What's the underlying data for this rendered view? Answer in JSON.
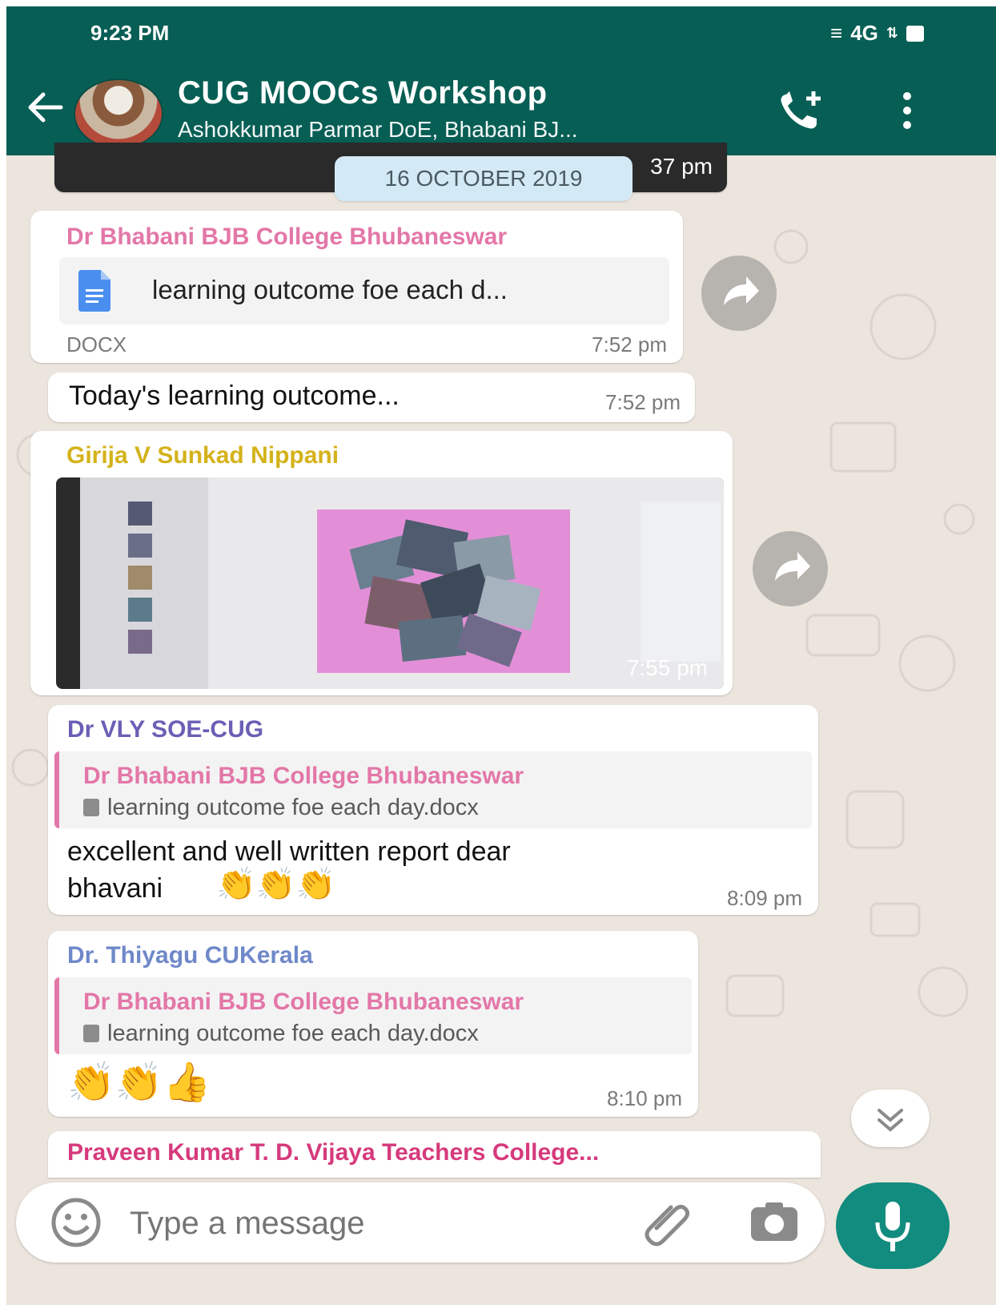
{
  "status_bar": {
    "time": "9:23 PM",
    "network": "4G"
  },
  "header": {
    "title": "CUG MOOCs Workshop",
    "subtitle": "Ashokkumar Parmar DoE, Bhabani BJ..."
  },
  "date_chip": "16 OCTOBER 2019",
  "partial_top_time": "37 pm",
  "messages": [
    {
      "sender": "Dr Bhabani BJB College Bhubaneswar",
      "sender_color": "#e377a8",
      "file_name": "learning outcome foe each d...",
      "file_type": "DOCX",
      "time": "7:52 pm"
    },
    {
      "text": "Today's learning outcome...",
      "time": "7:52 pm"
    },
    {
      "sender": "Girija V Sunkad Nippani",
      "sender_color": "#d4b21a",
      "time": "7:55 pm"
    },
    {
      "sender": "Dr VLY SOE-CUG",
      "sender_color": "#6a5fb5",
      "quote_sender": "Dr Bhabani BJB College Bhubaneswar",
      "quote_file": "learning outcome foe each day.docx",
      "text_line1": "excellent and well written report dear",
      "text_line2": "bhavani",
      "emojis": "👏👏👏",
      "time": "8:09 pm"
    },
    {
      "sender": "Dr. Thiyagu CUKerala",
      "sender_color": "#6f88c9",
      "quote_sender": "Dr Bhabani BJB College Bhubaneswar",
      "quote_file": "learning outcome foe each day.docx",
      "emojis": "👏👏👍",
      "time": "8:10 pm"
    },
    {
      "sender": "Praveen Kumar T. D. Vijaya Teachers College...",
      "sender_color": "#d63a7c"
    }
  ],
  "composer": {
    "placeholder": "Type a message"
  },
  "icons": [
    "back-arrow-icon",
    "add-call-icon",
    "more-vert-icon",
    "forward-icon",
    "doc-icon",
    "emoji-icon",
    "attach-icon",
    "camera-icon",
    "mic-icon",
    "chevron-down-icon"
  ]
}
